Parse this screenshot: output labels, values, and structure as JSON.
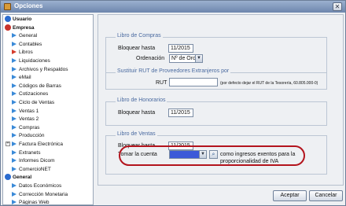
{
  "window": {
    "title": "Opciones",
    "close_glyph": "✕"
  },
  "tree": [
    {
      "label": "Usuario",
      "kind": "root",
      "icon": "user-root-icon",
      "color": "#2a6bcf"
    },
    {
      "label": "Empresa",
      "kind": "root",
      "icon": "company-root-icon",
      "color": "#c8322b"
    },
    {
      "label": "General",
      "kind": "child"
    },
    {
      "label": "Contables",
      "kind": "child"
    },
    {
      "label": "Libros",
      "kind": "child",
      "selected": true
    },
    {
      "label": "Liquidaciones",
      "kind": "child"
    },
    {
      "label": "Archivos y Respaldos",
      "kind": "child"
    },
    {
      "label": "eMail",
      "kind": "child"
    },
    {
      "label": "Códigos de Barras",
      "kind": "child"
    },
    {
      "label": "Cotizaciones",
      "kind": "child"
    },
    {
      "label": "Ciclo de Ventas",
      "kind": "child"
    },
    {
      "label": "Ventas 1",
      "kind": "child"
    },
    {
      "label": "Ventas 2",
      "kind": "child"
    },
    {
      "label": "Compras",
      "kind": "child"
    },
    {
      "label": "Producción",
      "kind": "child"
    },
    {
      "label": "Factura Electrónica",
      "kind": "child",
      "expander": "+"
    },
    {
      "label": "Extranets",
      "kind": "child"
    },
    {
      "label": "Informes Dicom",
      "kind": "child"
    },
    {
      "label": "ComercioNET",
      "kind": "child"
    },
    {
      "label": "General",
      "kind": "root",
      "icon": "general-root-icon",
      "color": "#2a6bcf"
    },
    {
      "label": "Datos Económicos",
      "kind": "child"
    },
    {
      "label": "Corrección Monetaria",
      "kind": "child"
    },
    {
      "label": "Páginas Web",
      "kind": "child"
    }
  ],
  "compras": {
    "legend": "Libro de Compras",
    "bloquear_label": "Bloquear hasta",
    "bloquear_value": "11/2015",
    "orden_label": "Ordenación",
    "orden_value": "Nº de Orden",
    "proveedores_legend": "Sustituir RUT de Proveedores Extranjeros por",
    "rut_label": "RUT",
    "rut_value": "",
    "rut_note": "(por defecto dejar el RUT de la Tesorería, 60.805.000-0)"
  },
  "honorarios": {
    "legend": "Libro de Honorarios",
    "bloquear_label": "Bloquear hasta",
    "bloquear_value": "11/2015"
  },
  "ventas": {
    "legend": "Libro de Ventas",
    "bloquear_label": "Bloquear hasta",
    "bloquear_value": "11/2015",
    "tomar_label": "Tomar la cuenta",
    "tomar_value": "",
    "tomar_desc_1": "como ingresos exentos para la",
    "tomar_desc_2": "proporcionalidad de IVA"
  },
  "buttons": {
    "accept": "Aceptar",
    "cancel": "Cancelar"
  },
  "colors": {
    "highlight": "#b3141d",
    "accent": "#4a6aa0",
    "selection": "#3c5ad8"
  }
}
